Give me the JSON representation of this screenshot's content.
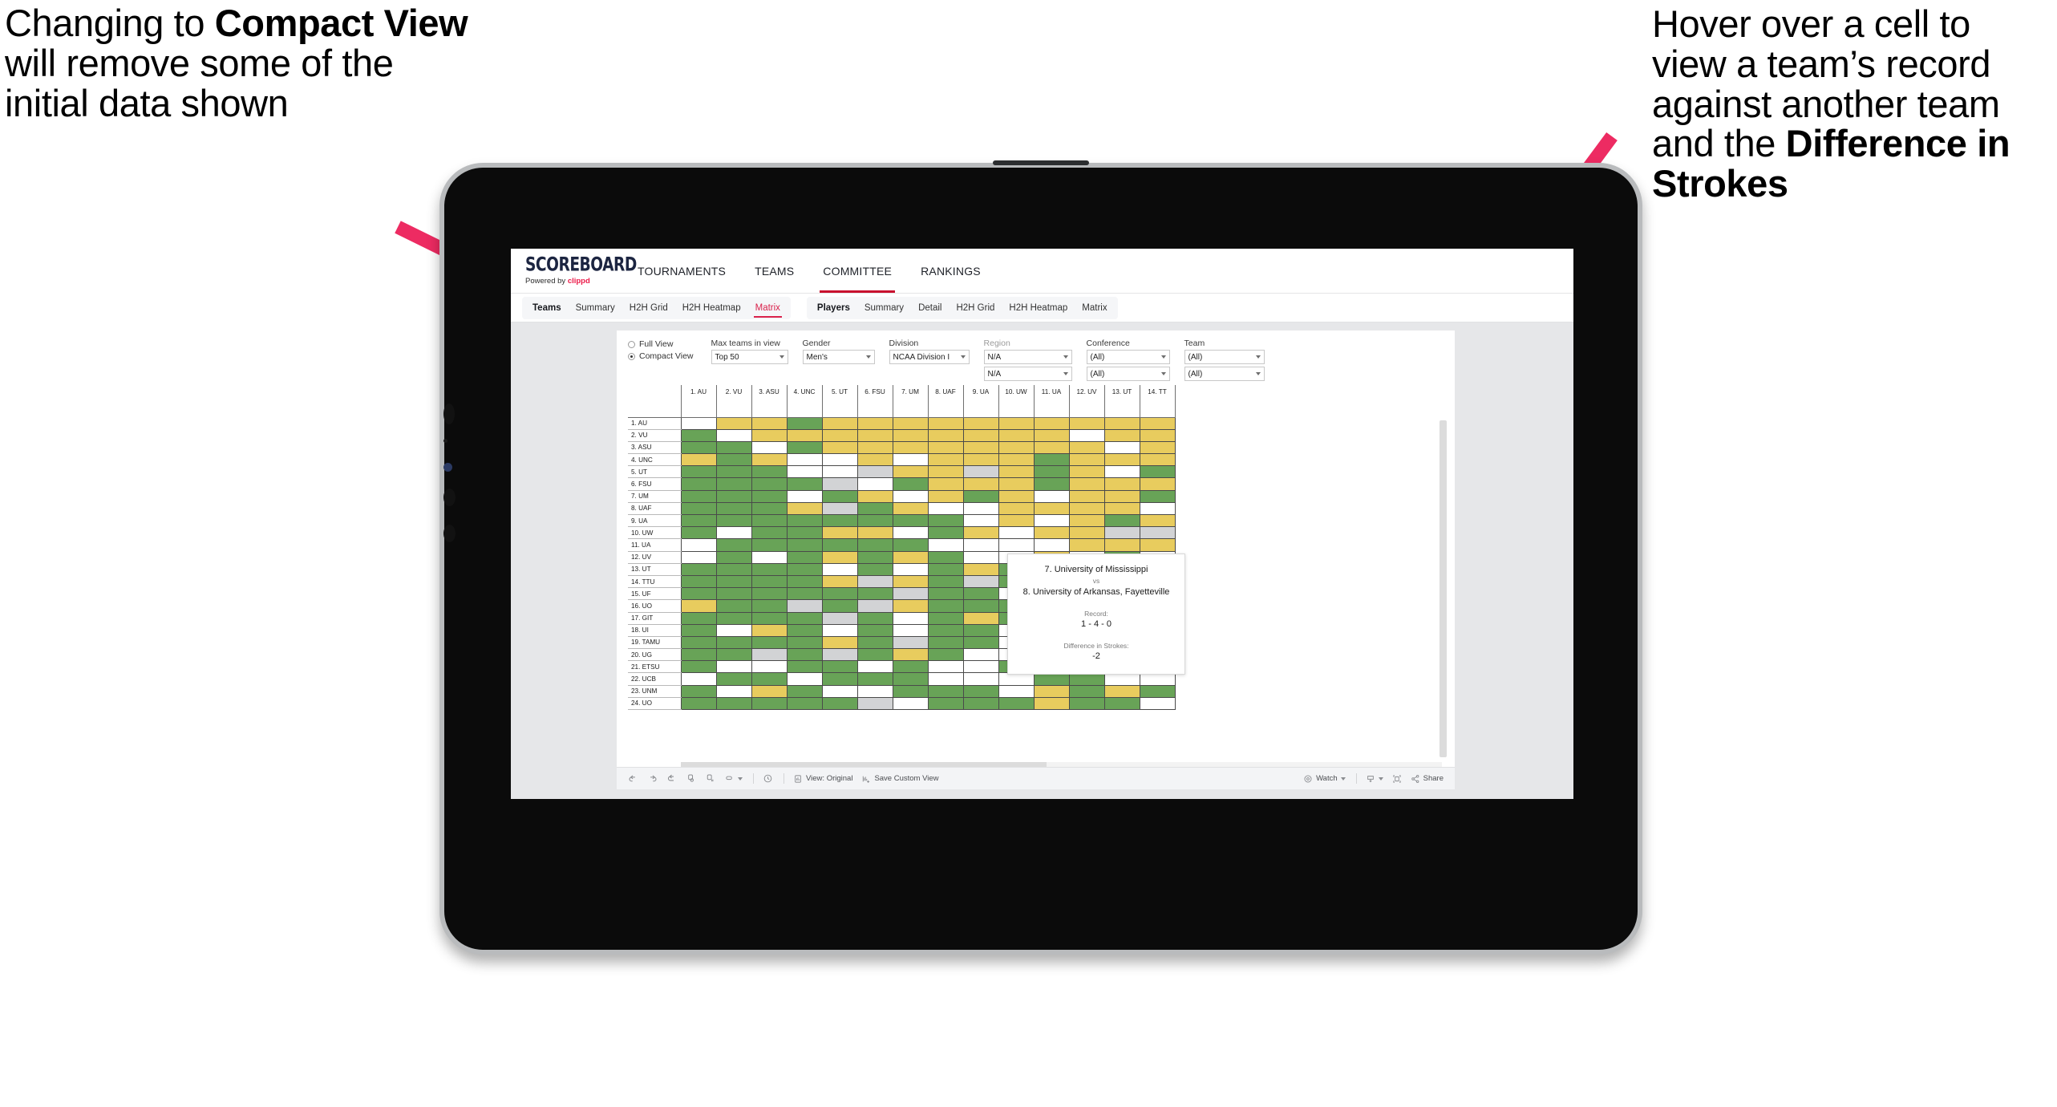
{
  "annotations": {
    "left": {
      "pre": "Changing to ",
      "bold": "Compact View",
      "post": " will remove some of the initial data shown"
    },
    "right": {
      "pre": "Hover over a cell to view a team’s record against another team and the ",
      "bold": "Difference in Strokes",
      "post": ""
    },
    "arrow_color": "#ED2B62"
  },
  "app": {
    "brand": {
      "logo": "SCOREBOARD",
      "powered_prefix": "Powered by ",
      "powered_brand": "clippd"
    },
    "topnav": [
      {
        "label": "TOURNAMENTS",
        "active": false
      },
      {
        "label": "TEAMS",
        "active": false
      },
      {
        "label": "COMMITTEE",
        "active": true
      },
      {
        "label": "RANKINGS",
        "active": false
      }
    ],
    "subnav": {
      "teams_group": [
        {
          "label": "Teams",
          "kind": "head"
        },
        {
          "label": "Summary",
          "kind": "item"
        },
        {
          "label": "H2H Grid",
          "kind": "item"
        },
        {
          "label": "H2H Heatmap",
          "kind": "item"
        },
        {
          "label": "Matrix",
          "kind": "sel"
        }
      ],
      "players_group": [
        {
          "label": "Players",
          "kind": "head"
        },
        {
          "label": "Summary",
          "kind": "item"
        },
        {
          "label": "Detail",
          "kind": "item"
        },
        {
          "label": "H2H Grid",
          "kind": "item"
        },
        {
          "label": "H2H Heatmap",
          "kind": "item"
        },
        {
          "label": "Matrix",
          "kind": "item"
        }
      ]
    },
    "filters": {
      "view_mode": {
        "full": "Full View",
        "compact": "Compact View",
        "selected": "Compact View"
      },
      "max_teams": {
        "label": "Max teams in view",
        "value": "Top 50"
      },
      "gender": {
        "label": "Gender",
        "value": "Men's"
      },
      "division": {
        "label": "Division",
        "value": "NCAA Division I"
      },
      "region": {
        "label": "Region",
        "value1": "N/A",
        "value2": "N/A"
      },
      "conference": {
        "label": "Conference",
        "value1": "(All)",
        "value2": "(All)"
      },
      "team": {
        "label": "Team",
        "value1": "(All)",
        "value2": "(All)"
      }
    },
    "toolbar": {
      "view_original": "View: Original",
      "save_custom_view": "Save Custom View",
      "watch": "Watch",
      "share": "Share"
    }
  },
  "tooltip": {
    "team_a": "7. University of Mississippi",
    "vs": "vs",
    "team_b": "8. University of Arkansas, Fayetteville",
    "record_label": "Record:",
    "record_value": "1 - 4 - 0",
    "diff_label": "Difference in Strokes:",
    "diff_value": "-2"
  },
  "chart_data": {
    "type": "heatmap",
    "title": "Team Head-to-Head Matrix",
    "legend_colors": {
      "win": "#68a357",
      "loss": "#e8cc5e",
      "tie": "#d2d3d5",
      "none": "#ffffff"
    },
    "columns": [
      "1. AU",
      "2. VU",
      "3. ASU",
      "4. UNC",
      "5. UT",
      "6. FSU",
      "7. UM",
      "8. UAF",
      "9. UA",
      "10. UW",
      "11. UA",
      "12. UV",
      "13. UT",
      "14. TT"
    ],
    "rows": [
      "1. AU",
      "2. VU",
      "3. ASU",
      "4. UNC",
      "5. UT",
      "6. FSU",
      "7. UM",
      "8. UAF",
      "9. UA",
      "10. UW",
      "11. UA",
      "12. UV",
      "13. UT",
      "14. TTU",
      "15. UF",
      "16. UO",
      "17. GIT",
      "18. UI",
      "19. TAMU",
      "20. UG",
      "21. ETSU",
      "22. UCB",
      "23. UNM",
      "24. UO"
    ],
    "cells": [
      [
        "w",
        "y",
        "y",
        "g",
        "y",
        "y",
        "y",
        "y",
        "y",
        "y",
        "y",
        "y",
        "y",
        "y"
      ],
      [
        "g",
        "w",
        "y",
        "y",
        "y",
        "y",
        "y",
        "y",
        "y",
        "y",
        "y",
        "w",
        "y",
        "y"
      ],
      [
        "g",
        "g",
        "w",
        "g",
        "y",
        "y",
        "y",
        "y",
        "y",
        "y",
        "y",
        "y",
        "w",
        "y"
      ],
      [
        "y",
        "g",
        "y",
        "w",
        "w",
        "y",
        "w",
        "y",
        "y",
        "y",
        "g",
        "y",
        "y",
        "y"
      ],
      [
        "g",
        "g",
        "g",
        "w",
        "w",
        "k",
        "y",
        "y",
        "k",
        "y",
        "g",
        "y",
        "w",
        "g"
      ],
      [
        "g",
        "g",
        "g",
        "g",
        "k",
        "w",
        "g",
        "y",
        "y",
        "y",
        "g",
        "y",
        "y",
        "y"
      ],
      [
        "g",
        "g",
        "g",
        "w",
        "g",
        "y",
        "w",
        "y",
        "g",
        "y",
        "w",
        "y",
        "y",
        "g"
      ],
      [
        "g",
        "g",
        "g",
        "y",
        "k",
        "g",
        "y",
        "w",
        "w",
        "y",
        "y",
        "y",
        "y",
        "w"
      ],
      [
        "g",
        "g",
        "g",
        "g",
        "g",
        "g",
        "g",
        "g",
        "w",
        "y",
        "w",
        "y",
        "g",
        "y"
      ],
      [
        "g",
        "w",
        "g",
        "g",
        "y",
        "y",
        "w",
        "g",
        "y",
        "w",
        "y",
        "y",
        "k",
        "k"
      ],
      [
        "w",
        "g",
        "g",
        "g",
        "g",
        "g",
        "g",
        "w",
        "w",
        "w",
        "w",
        "y",
        "y",
        "y"
      ],
      [
        "w",
        "g",
        "w",
        "g",
        "y",
        "g",
        "y",
        "g",
        "w",
        "w",
        "y",
        "w",
        "g",
        "w"
      ],
      [
        "g",
        "g",
        "g",
        "g",
        "w",
        "g",
        "w",
        "g",
        "y",
        "g",
        "g",
        "y",
        "w",
        "y"
      ],
      [
        "g",
        "g",
        "g",
        "g",
        "y",
        "k",
        "y",
        "g",
        "k",
        "g",
        "y",
        "g",
        "y",
        "w"
      ],
      [
        "g",
        "g",
        "g",
        "g",
        "g",
        "g",
        "k",
        "g",
        "g",
        "w",
        "y",
        "g",
        "y",
        "y"
      ],
      [
        "y",
        "g",
        "g",
        "k",
        "g",
        "k",
        "y",
        "g",
        "g",
        "g",
        "k",
        "y",
        "g",
        "w"
      ],
      [
        "g",
        "g",
        "g",
        "g",
        "k",
        "g",
        "w",
        "g",
        "y",
        "g",
        "g",
        "y",
        "g",
        "y"
      ],
      [
        "g",
        "w",
        "y",
        "g",
        "w",
        "g",
        "w",
        "g",
        "g",
        "w",
        "y",
        "g",
        "w",
        "k"
      ],
      [
        "g",
        "g",
        "g",
        "g",
        "y",
        "g",
        "k",
        "g",
        "g",
        "w",
        "g",
        "w",
        "g",
        "y"
      ],
      [
        "g",
        "g",
        "k",
        "g",
        "k",
        "g",
        "y",
        "g",
        "w",
        "w",
        "g",
        "g",
        "y",
        "y"
      ],
      [
        "g",
        "w",
        "w",
        "g",
        "g",
        "w",
        "g",
        "w",
        "w",
        "g",
        "y",
        "w",
        "g",
        "y"
      ],
      [
        "w",
        "g",
        "g",
        "w",
        "g",
        "g",
        "g",
        "w",
        "w",
        "w",
        "g",
        "g",
        "w",
        "w"
      ],
      [
        "g",
        "w",
        "y",
        "g",
        "w",
        "w",
        "g",
        "g",
        "g",
        "w",
        "y",
        "g",
        "y",
        "g"
      ],
      [
        "g",
        "g",
        "g",
        "g",
        "g",
        "k",
        "w",
        "g",
        "g",
        "g",
        "y",
        "g",
        "g",
        "w"
      ]
    ]
  }
}
